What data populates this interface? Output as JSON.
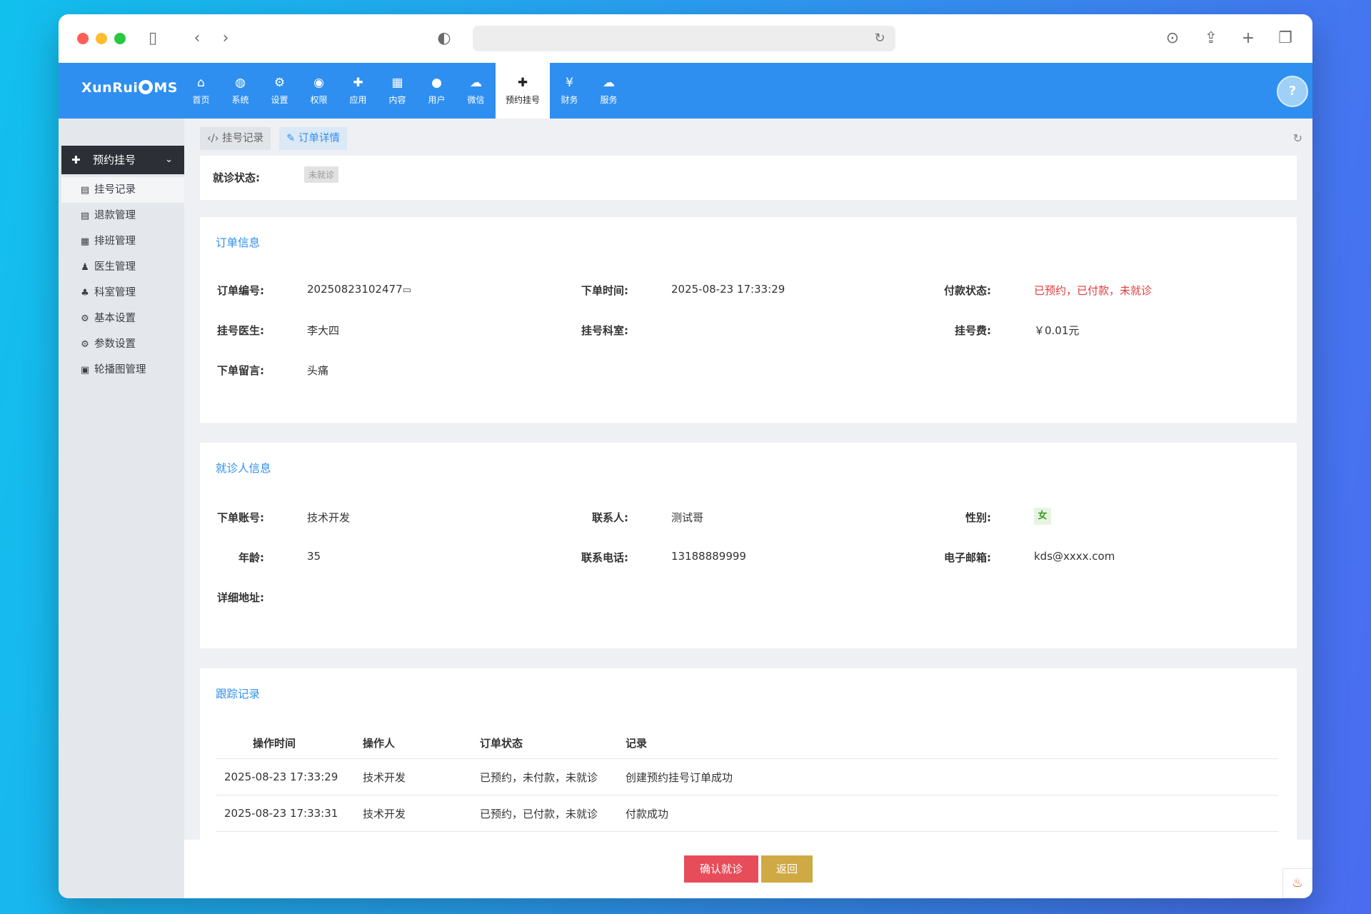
{
  "app": {
    "logo_text_a": "XunRui",
    "logo_text_b": "MS"
  },
  "nav": [
    {
      "icon": "home-icon",
      "glyph": "⌂",
      "label": "首页"
    },
    {
      "icon": "globe-icon",
      "glyph": "◍",
      "label": "系统"
    },
    {
      "icon": "cogs-icon",
      "glyph": "⚙",
      "label": "设置"
    },
    {
      "icon": "user-circle-icon",
      "glyph": "◉",
      "label": "权限"
    },
    {
      "icon": "puzzle-icon",
      "glyph": "✚",
      "label": "应用"
    },
    {
      "icon": "grid-icon",
      "glyph": "▦",
      "label": "内容"
    },
    {
      "icon": "user-icon",
      "glyph": "●",
      "label": "用户"
    },
    {
      "icon": "wechat-icon",
      "glyph": "☁",
      "label": "微信"
    },
    {
      "icon": "medkit-icon",
      "glyph": "✚",
      "label": "预约挂号"
    },
    {
      "icon": "yen-icon",
      "glyph": "¥",
      "label": "财务"
    },
    {
      "icon": "cloud-icon",
      "glyph": "☁",
      "label": "服务"
    }
  ],
  "help_glyph": "?",
  "sidebar": {
    "header": "预约挂号",
    "items": [
      {
        "icon": "file-icon",
        "glyph": "▤",
        "label": "挂号记录"
      },
      {
        "icon": "file-icon",
        "glyph": "▤",
        "label": "退款管理"
      },
      {
        "icon": "table-icon",
        "glyph": "▦",
        "label": "排班管理"
      },
      {
        "icon": "doctor-icon",
        "glyph": "♟",
        "label": "医生管理"
      },
      {
        "icon": "sitemap-icon",
        "glyph": "♣",
        "label": "科室管理"
      },
      {
        "icon": "gear-icon",
        "glyph": "⚙",
        "label": "基本设置"
      },
      {
        "icon": "gear-icon",
        "glyph": "⚙",
        "label": "参数设置"
      },
      {
        "icon": "image-icon",
        "glyph": "▣",
        "label": "轮播图管理"
      }
    ]
  },
  "tabs": [
    {
      "icon": "code-icon",
      "glyph": "‹/›",
      "label": "挂号记录"
    },
    {
      "icon": "edit-icon",
      "glyph": "✎",
      "label": "订单详情"
    }
  ],
  "visit_status": {
    "label": "就诊状态:",
    "value": "未就诊"
  },
  "order_info": {
    "title": "订单信息",
    "order_no_label": "订单编号:",
    "order_no": "20250823102477",
    "order_time_label": "下单时间:",
    "order_time": "2025-08-23 17:33:29",
    "pay_status_label": "付款状态:",
    "pay_status": "已预约，已付款，未就诊",
    "doctor_label": "挂号医生:",
    "doctor": "李大四",
    "dept_label": "挂号科室:",
    "dept": "",
    "fee_label": "挂号费:",
    "fee": "￥0.01元",
    "note_label": "下单留言:",
    "note": "头痛"
  },
  "patient_info": {
    "title": "就诊人信息",
    "account_label": "下单账号:",
    "account": "技术开发",
    "contact_label": "联系人:",
    "contact": "测试哥",
    "sex_label": "性别:",
    "sex": "女",
    "age_label": "年龄:",
    "age": "35",
    "phone_label": "联系电话:",
    "phone": "13188889999",
    "email_label": "电子邮箱:",
    "email": "kds@xxxx.com",
    "address_label": "详细地址:",
    "address": ""
  },
  "tracking": {
    "title": "跟踪记录",
    "headers": [
      "操作时间",
      "操作人",
      "订单状态",
      "记录"
    ],
    "rows": [
      [
        "2025-08-23 17:33:29",
        "技术开发",
        "已预约，未付款，未就诊",
        "创建预约挂号订单成功"
      ],
      [
        "2025-08-23 17:33:31",
        "技术开发",
        "已预约，已付款，未就诊",
        "付款成功"
      ]
    ]
  },
  "buttons": {
    "confirm": "确认就诊",
    "back": "返回"
  },
  "colors": {
    "brand": "#2f8ff0",
    "danger": "#e03c3c",
    "confirm": "#e64c5a",
    "back": "#cfa944"
  }
}
